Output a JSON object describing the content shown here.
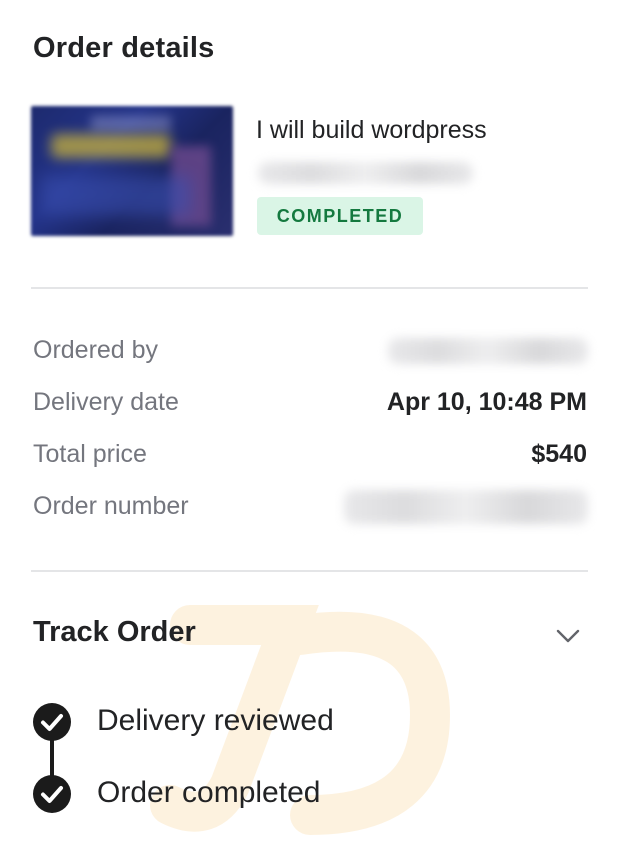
{
  "page": {
    "title": "Order details"
  },
  "gig": {
    "title": "I will build wordpress",
    "status_badge": "COMPLETED"
  },
  "summary": {
    "ordered_by_label": "Ordered by",
    "delivery_date_label": "Delivery date",
    "delivery_date_value": "Apr 10, 10:48 PM",
    "total_price_label": "Total price",
    "total_price_value": "$540",
    "order_number_label": "Order number"
  },
  "track": {
    "title": "Track Order",
    "steps": [
      {
        "label": "Delivery reviewed",
        "icon": "check-circle-icon"
      },
      {
        "label": "Order completed",
        "icon": "check-circle-icon"
      }
    ]
  },
  "colors": {
    "badge_bg": "#daf5e6",
    "badge_text": "#14793f",
    "label_gray": "#74767e",
    "text_dark": "#222325",
    "watermark": "#f5a623"
  }
}
